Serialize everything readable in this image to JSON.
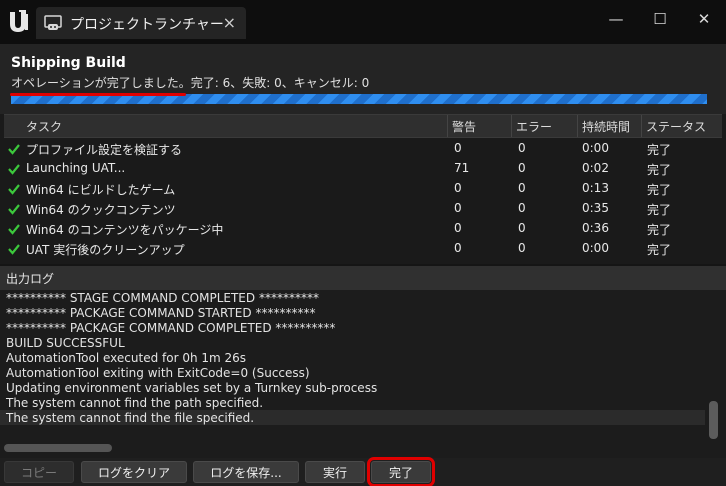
{
  "window": {
    "tab_title": "プロジェクトランチャー",
    "tab_close": "×",
    "minimize": "—",
    "maximize": "☐",
    "close": "✕"
  },
  "job": {
    "title": "Shipping Build",
    "status_text": "オペレーションが完了しました。完了: 6、失敗: 0、キャンセル: 0",
    "progress": 1.0
  },
  "table": {
    "headers": [
      "タスク",
      "警告",
      "エラー",
      "持続時間",
      "ステータス"
    ],
    "rows": [
      {
        "task": "プロファイル設定を検証する",
        "warnings": "0",
        "errors": "0",
        "duration": "0:00",
        "status": "完了"
      },
      {
        "task": "Launching UAT...",
        "warnings": "71",
        "errors": "0",
        "duration": "0:02",
        "status": "完了"
      },
      {
        "task": "Win64 にビルドしたゲーム",
        "warnings": "0",
        "errors": "0",
        "duration": "0:13",
        "status": "完了"
      },
      {
        "task": "Win64 のクックコンテンツ",
        "warnings": "0",
        "errors": "0",
        "duration": "0:35",
        "status": "完了"
      },
      {
        "task": "Win64 のコンテンツをパッケージ中",
        "warnings": "0",
        "errors": "0",
        "duration": "0:36",
        "status": "完了"
      },
      {
        "task": "UAT 実行後のクリーンアップ",
        "warnings": "0",
        "errors": "0",
        "duration": "0:00",
        "status": "完了"
      }
    ]
  },
  "log": {
    "title": "出力ログ",
    "lines": [
      "********** STAGE COMMAND COMPLETED **********",
      "********** PACKAGE COMMAND STARTED **********",
      "********** PACKAGE COMMAND COMPLETED **********",
      "BUILD SUCCESSFUL",
      "AutomationTool executed for 0h 1m 26s",
      "AutomationTool exiting with ExitCode=0 (Success)",
      "Updating environment variables set by a Turnkey sub-process",
      "The system cannot find the path specified.",
      "The system cannot find the file specified."
    ]
  },
  "buttons": {
    "copy": "コピー",
    "clear_log": "ログをクリア",
    "save_log": "ログを保存...",
    "run": "実行",
    "done": "完了"
  },
  "colors": {
    "highlight": "#e00000",
    "progress": "#2f8ef0",
    "check": "#3cc83c"
  }
}
